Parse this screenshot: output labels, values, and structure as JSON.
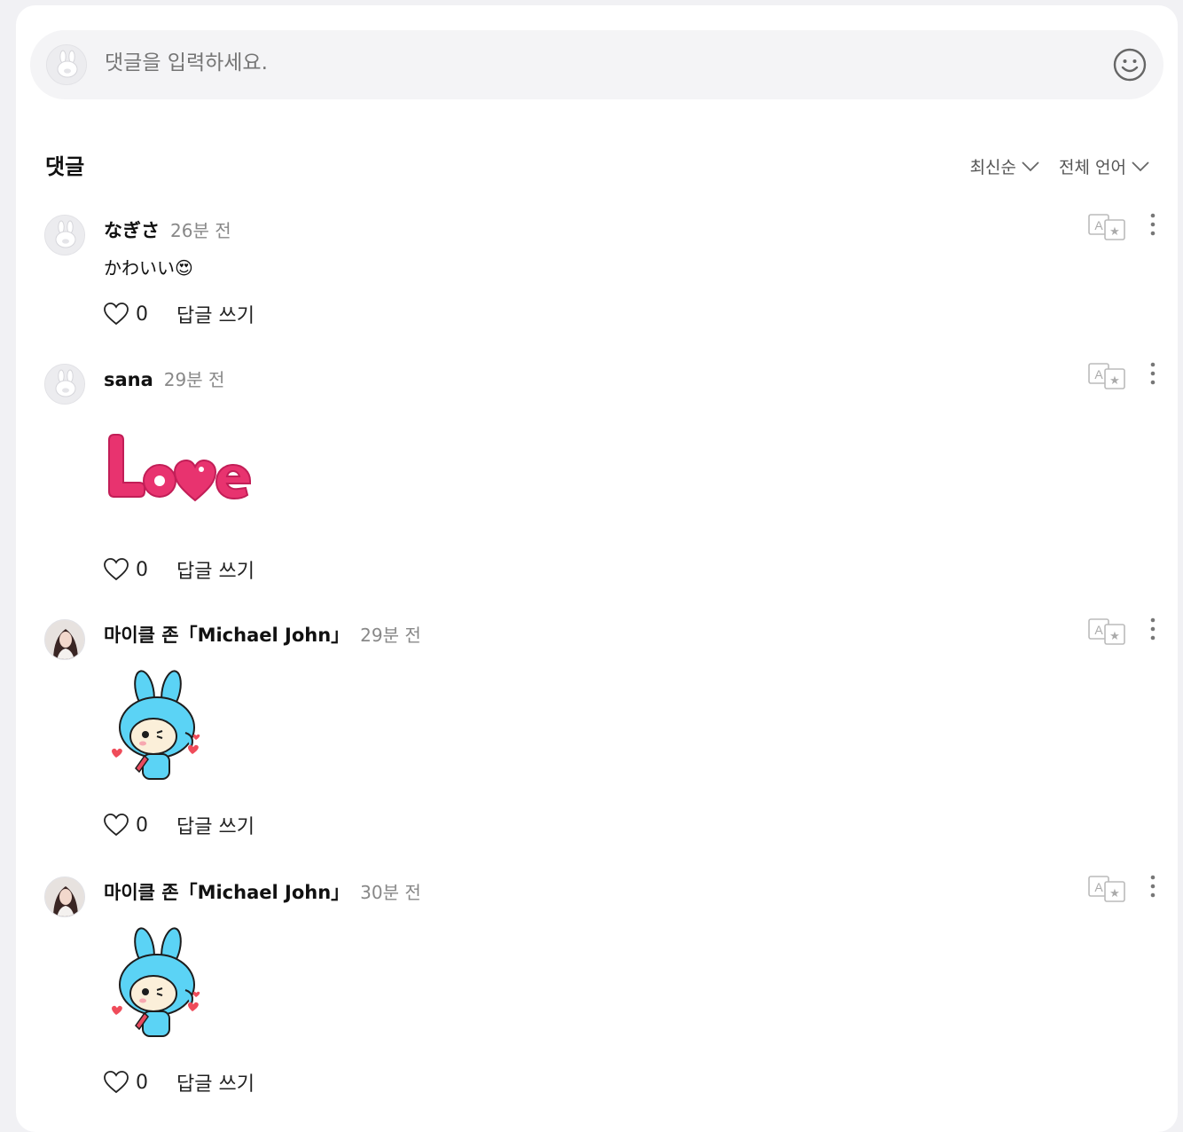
{
  "input": {
    "placeholder": "댓글을 입력하세요."
  },
  "section": {
    "title": "댓글"
  },
  "sort": {
    "order": "최신순",
    "language": "전체 언어"
  },
  "comments": [
    {
      "name": "なぎさ",
      "time": "26분 전",
      "text": "かわいい😍",
      "likes": "0",
      "reply": "답글 쓰기"
    },
    {
      "name": "sana",
      "time": "29분 전",
      "sticker": "love-sticker",
      "likes": "0",
      "reply": "답글 쓰기"
    },
    {
      "name": "마이클 존「Michael John」",
      "time": "29분 전",
      "sticker": "blue-bunny-sticker",
      "likes": "0",
      "reply": "답글 쓰기"
    },
    {
      "name": "마이클 존「Michael John」",
      "time": "30분 전",
      "sticker": "blue-bunny-sticker",
      "likes": "0",
      "reply": "답글 쓰기"
    }
  ],
  "icons": {
    "default_avatar": "bunny-avatar-icon",
    "emoji": "smiley-icon",
    "translate": "translate-icon",
    "more": "more-vertical-icon",
    "like": "heart-outline-icon",
    "dropdown": "chevron-down-icon"
  },
  "colors": {
    "love": "#e8336f",
    "bunny": "#5bd3f5"
  }
}
